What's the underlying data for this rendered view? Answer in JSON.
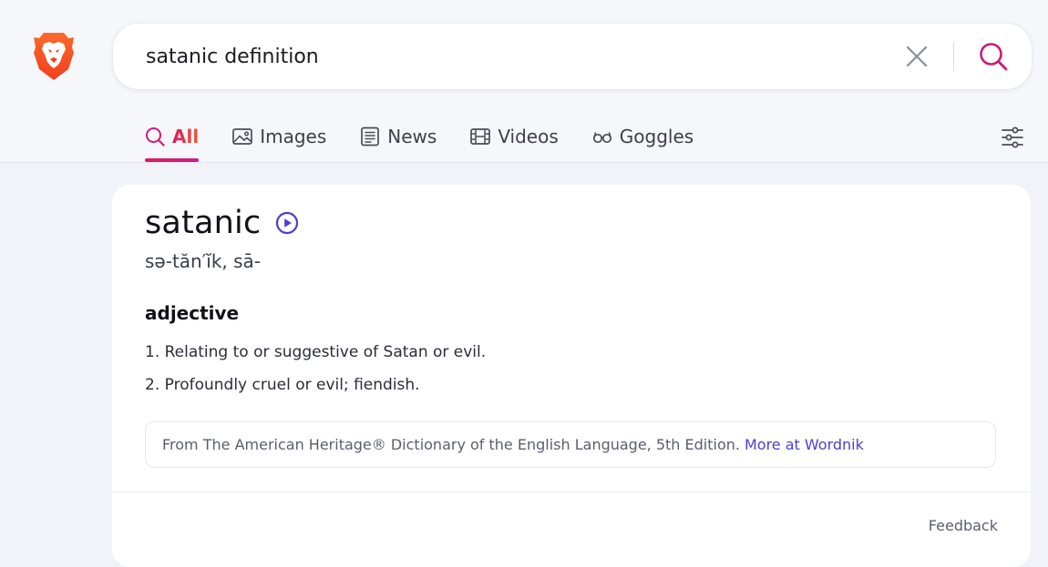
{
  "header": {
    "logo_icon": "brave-lion-icon",
    "search": {
      "value": "satanic definition",
      "clear_icon": "close-icon",
      "submit_icon": "search-icon"
    },
    "tabs": [
      {
        "label": "All",
        "icon": "search-icon",
        "active": true
      },
      {
        "label": "Images",
        "icon": "image-icon",
        "active": false
      },
      {
        "label": "News",
        "icon": "news-icon",
        "active": false
      },
      {
        "label": "Videos",
        "icon": "film-icon",
        "active": false
      },
      {
        "label": "Goggles",
        "icon": "goggles-icon",
        "active": false
      }
    ],
    "settings_icon": "sliders-icon"
  },
  "definition_card": {
    "word": "satanic",
    "audio_icon": "play-circle-icon",
    "pronunciation": "sə-tăn′ĭk, sā-",
    "part_of_speech": "adjective",
    "definitions": [
      "1. Relating to or suggestive of Satan or evil.",
      "2. Profoundly cruel or evil; fiendish."
    ],
    "source_text": "From The American Heritage® Dictionary of the English Language, 5th Edition.",
    "source_link": "More at Wordnik",
    "feedback_label": "Feedback"
  },
  "colors": {
    "accent_gradient_start": "#e0185e",
    "accent_gradient_end": "#f0562e",
    "link": "#4a3fd0",
    "search_icon": "#c81d8a",
    "brave_orange": "#fb542b"
  }
}
